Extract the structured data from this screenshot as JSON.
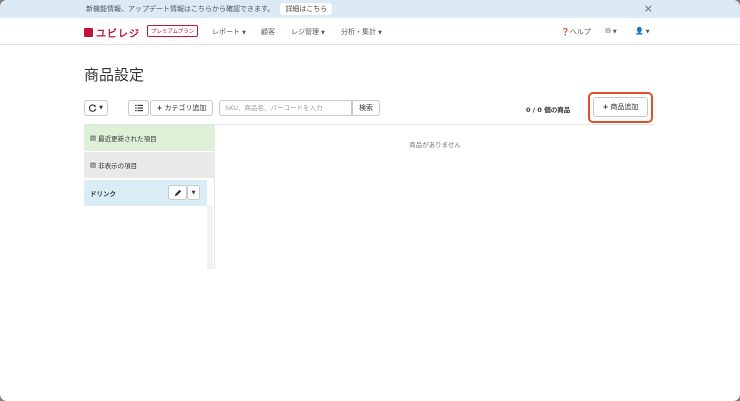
{
  "info_bar": {
    "text": "新機能情報、アップデート情報はこちらから確認できます。",
    "link": "詳細はこちら",
    "close": "×"
  },
  "navbar": {
    "logo": "ユビレジ",
    "plan_badge": "プレミアムプラン",
    "items": [
      {
        "label": "レポート",
        "caret": true
      },
      {
        "label": "顧客",
        "caret": false
      },
      {
        "label": "レジ管理",
        "caret": true
      },
      {
        "label": "分析・集計",
        "caret": true
      }
    ],
    "help": "ヘルプ"
  },
  "page": {
    "title": "商品設定"
  },
  "toolbar": {
    "add_category": "カテゴリ追加",
    "search_placeholder": "SKU、商品名、バーコードを入力",
    "search_button": "検索",
    "count": "0 / 0 個の商品",
    "add_product": "商品追加"
  },
  "categories": [
    {
      "label": "最近更新された項目",
      "bg": "#dff0d8"
    },
    {
      "label": "非表示の項目",
      "bg": "#e9e9e9"
    },
    {
      "label": "ドリンク",
      "bg": "#d9edf7"
    }
  ],
  "main": {
    "empty_message": "商品がありません"
  },
  "colors": {
    "brand": "#c0143c",
    "highlight": "#e0502a"
  }
}
